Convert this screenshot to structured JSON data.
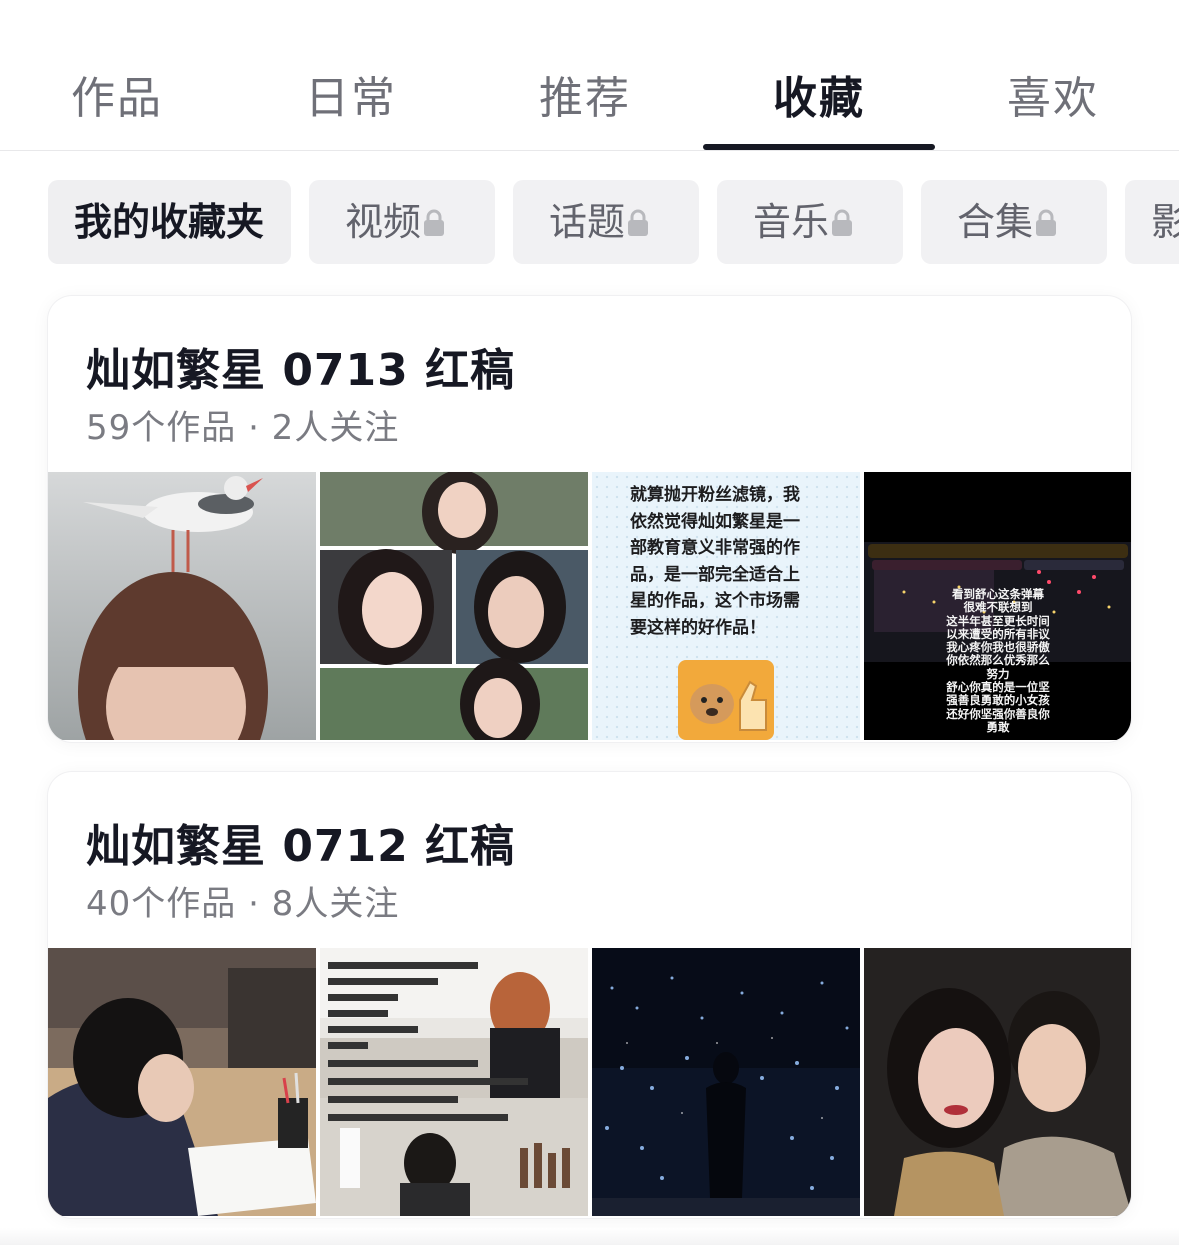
{
  "tabs": [
    "作品",
    "日常",
    "推荐",
    "收藏",
    "喜欢"
  ],
  "active_tab": "收藏",
  "chips": [
    {
      "label": "我的收藏夹",
      "locked": false
    },
    {
      "label": "视频",
      "locked": true
    },
    {
      "label": "话题",
      "locked": true
    },
    {
      "label": "音乐",
      "locked": true
    },
    {
      "label": "合集",
      "locked": true
    },
    {
      "label": "影",
      "locked": false
    }
  ],
  "collections": [
    {
      "title": "灿如繁星 0713 红稿",
      "meta": "59个作品 · 2人关注",
      "thumb3_text": {
        "lines": [
          "就算抛开粉丝滤镜，我",
          "依然觉得灿如繁星是一",
          "部教育意义非常强的作",
          "品，是一部完全适合上",
          "星的作品，这个市场需",
          "要这样的好作品！"
        ]
      },
      "thumb4_text": {
        "lines": [
          "看到舒心这条弹幕",
          "很难不联想到",
          "这半年甚至更长时间",
          "以来遭受的所有非议",
          "我心疼你我也很骄傲",
          "你依然那么优秀那么",
          "努力",
          "舒心你真的是一位坚",
          "强善良勇敢的小女孩",
          "还好你坚强你善良你",
          "勇敢"
        ]
      }
    },
    {
      "title": "灿如繁星 0712 红稿",
      "meta": "40个作品 · 8人关注"
    }
  ],
  "colors": {
    "text_primary": "#161823",
    "text_secondary": "#7a7b82",
    "chip_bg": "#f1f1f3",
    "lock": "#b8b9bd",
    "highlight_blue": "#2a8bd8"
  }
}
